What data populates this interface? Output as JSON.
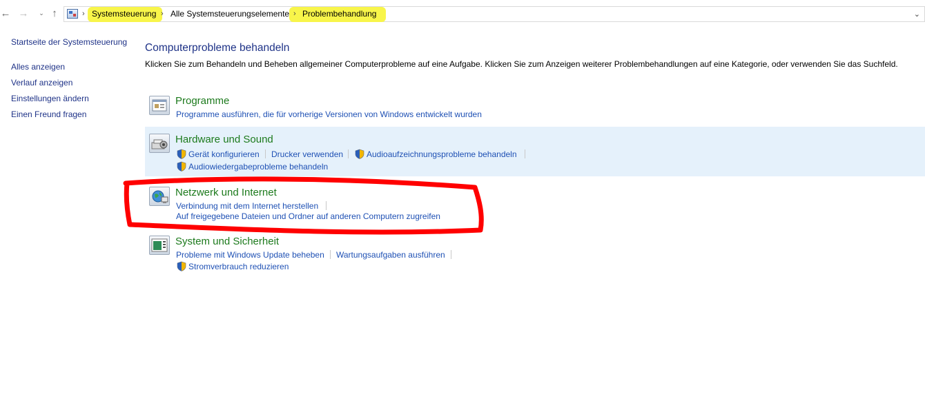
{
  "address_bar": {
    "breadcrumbs": [
      "Systemsteuerung",
      "Alle Systemsteuerungselemente",
      "Problembehandlung"
    ]
  },
  "sidebar": {
    "items": [
      {
        "label": "Startseite der Systemsteuerung"
      },
      {
        "label": "Alles anzeigen"
      },
      {
        "label": "Verlauf anzeigen"
      },
      {
        "label": "Einstellungen ändern"
      },
      {
        "label": "Einen Freund fragen"
      }
    ]
  },
  "main": {
    "title": "Computerprobleme behandeln",
    "description": "Klicken Sie zum Behandeln und Beheben allgemeiner Computerprobleme auf eine Aufgabe. Klicken Sie zum Anzeigen weiterer Problembehandlungen auf eine Kategorie, oder verwenden Sie das Suchfeld.",
    "categories": [
      {
        "title": "Programme",
        "tasks": [
          "Programme ausführen, die für vorherige Versionen von Windows entwickelt wurden"
        ]
      },
      {
        "title": "Hardware und Sound",
        "tasks": [
          "Gerät konfigurieren",
          "Drucker verwenden",
          "Audioaufzeichnungsprobleme behandeln",
          "Audiowiedergabeprobleme behandeln"
        ]
      },
      {
        "title": "Netzwerk und Internet",
        "tasks": [
          "Verbindung mit dem Internet herstellen",
          "Auf freigegebene Dateien und Ordner auf anderen Computern zugreifen"
        ]
      },
      {
        "title": "System und Sicherheit",
        "tasks": [
          "Probleme mit Windows Update beheben",
          "Wartungsaufgaben ausführen",
          "Stromverbrauch reduzieren"
        ]
      }
    ]
  },
  "annotations": {
    "highlight_color": "#f8f54a",
    "circle_color": "#ff0000"
  },
  "colors": {
    "link": "#1e50b4",
    "heading": "#1e3287",
    "category_title": "#1c7a1c",
    "hover_row": "#e5f1fb"
  }
}
